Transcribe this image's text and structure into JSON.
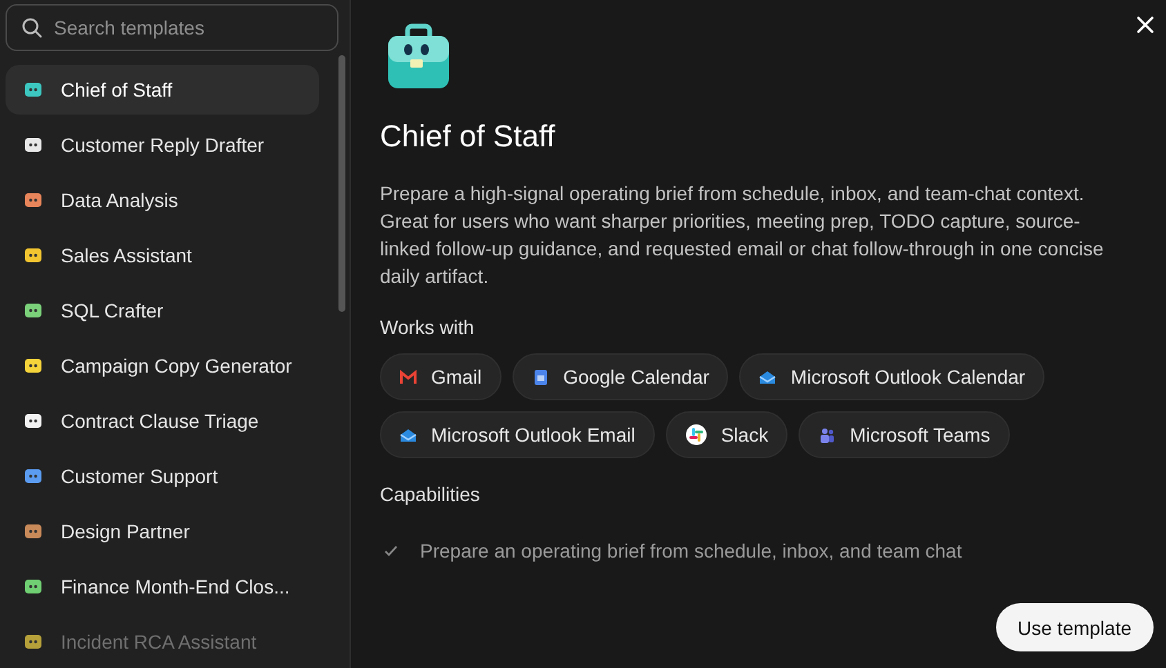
{
  "search": {
    "placeholder": "Search templates"
  },
  "templates": [
    {
      "label": "Chief of Staff",
      "selected": true,
      "color": "#3cc7c0"
    },
    {
      "label": "Customer Reply Drafter",
      "selected": false,
      "color": "#e8e8e8"
    },
    {
      "label": "Data Analysis",
      "selected": false,
      "color": "#e8855a"
    },
    {
      "label": "Sales Assistant",
      "selected": false,
      "color": "#f2c530"
    },
    {
      "label": "SQL Crafter",
      "selected": false,
      "color": "#7bd17a"
    },
    {
      "label": "Campaign Copy Generator",
      "selected": false,
      "color": "#f5d33a"
    },
    {
      "label": "Contract Clause Triage",
      "selected": false,
      "color": "#f2f2f2"
    },
    {
      "label": "Customer Support",
      "selected": false,
      "color": "#5b9cf0"
    },
    {
      "label": "Design Partner",
      "selected": false,
      "color": "#c98a5a"
    },
    {
      "label": "Finance Month-End Clos...",
      "selected": false,
      "color": "#6fcf72"
    },
    {
      "label": "Incident RCA Assistant",
      "selected": false,
      "color": "#b5a03a"
    }
  ],
  "detail": {
    "title": "Chief of Staff",
    "description": "Prepare a high-signal operating brief from schedule, inbox, and team-chat context. Great for users who want sharper priorities, meeting prep, TODO capture, source-linked follow-up guidance, and requested email or chat follow-through in one concise daily artifact.",
    "works_with_heading": "Works with",
    "integrations": [
      {
        "label": "Gmail",
        "kind": "gmail"
      },
      {
        "label": "Google Calendar",
        "kind": "calendar"
      },
      {
        "label": "Microsoft Outlook Calendar",
        "kind": "outlook"
      },
      {
        "label": "Microsoft Outlook Email",
        "kind": "outlook"
      },
      {
        "label": "Slack",
        "kind": "slack"
      },
      {
        "label": "Microsoft Teams",
        "kind": "teams"
      }
    ],
    "capabilities_heading": "Capabilities",
    "capabilities": [
      "Prepare an operating brief from schedule, inbox, and team chat"
    ],
    "button": "Use template"
  }
}
